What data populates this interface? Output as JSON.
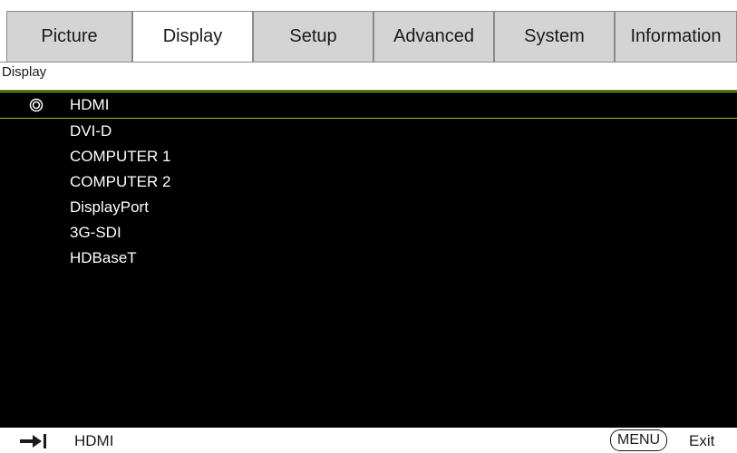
{
  "tabs": [
    {
      "label": "Picture",
      "active": false
    },
    {
      "label": "Display",
      "active": true
    },
    {
      "label": "Setup",
      "active": false
    },
    {
      "label": "Advanced",
      "active": false
    },
    {
      "label": "System",
      "active": false
    },
    {
      "label": "Information",
      "active": false
    }
  ],
  "section": {
    "title": "Display"
  },
  "inputs": [
    {
      "label": "HDMI",
      "selected": true
    },
    {
      "label": "DVI-D",
      "selected": false
    },
    {
      "label": "COMPUTER 1",
      "selected": false
    },
    {
      "label": "COMPUTER 2",
      "selected": false
    },
    {
      "label": "DisplayPort",
      "selected": false
    },
    {
      "label": "3G-SDI",
      "selected": false
    },
    {
      "label": "HDBaseT",
      "selected": false
    }
  ],
  "footer": {
    "source_icon": "input-source-icon",
    "source_label": "HDMI",
    "menu_key": "MENU",
    "exit_label": "Exit"
  },
  "colors": {
    "highlight": "#9acd32",
    "panel_bg": "#000000",
    "tab_inactive": "#d4d4d4"
  }
}
